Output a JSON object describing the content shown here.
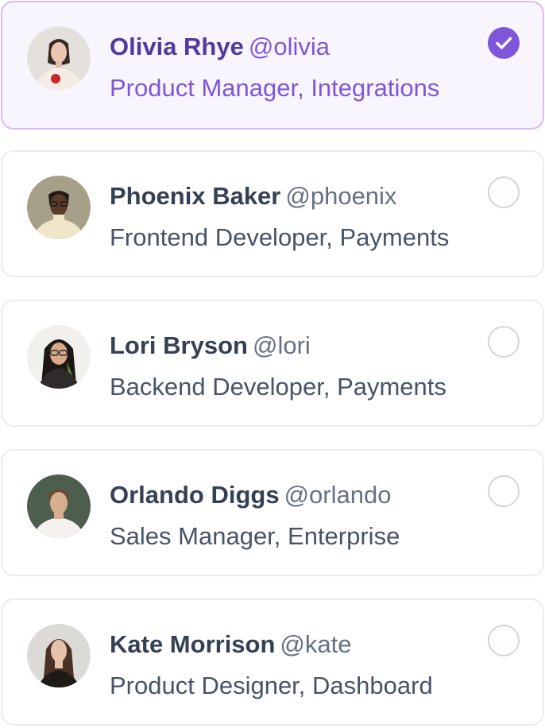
{
  "users": [
    {
      "name": "Olivia Rhye",
      "handle": "@olivia",
      "role": "Product Manager, Integrations",
      "selected": true,
      "avatar_icon": "avatar-photo-olivia"
    },
    {
      "name": "Phoenix Baker",
      "handle": "@phoenix",
      "role": "Frontend Developer, Payments",
      "selected": false,
      "avatar_icon": "avatar-photo-phoenix"
    },
    {
      "name": "Lori Bryson",
      "handle": "@lori",
      "role": "Backend Developer, Payments",
      "selected": false,
      "avatar_icon": "avatar-photo-lori"
    },
    {
      "name": "Orlando Diggs",
      "handle": "@orlando",
      "role": "Sales Manager, Enterprise",
      "selected": false,
      "avatar_icon": "avatar-photo-orlando"
    },
    {
      "name": "Kate Morrison",
      "handle": "@kate",
      "role": "Product Designer, Dashboard",
      "selected": false,
      "avatar_icon": "avatar-photo-kate"
    }
  ],
  "colors": {
    "selected_border": "#D6BBFB",
    "selected_background": "#F9F5FF",
    "accent": "#7F56D9",
    "selected_name": "#53389E",
    "default_border": "#EAECF0",
    "name_text": "#344054",
    "secondary_text": "#475467"
  }
}
